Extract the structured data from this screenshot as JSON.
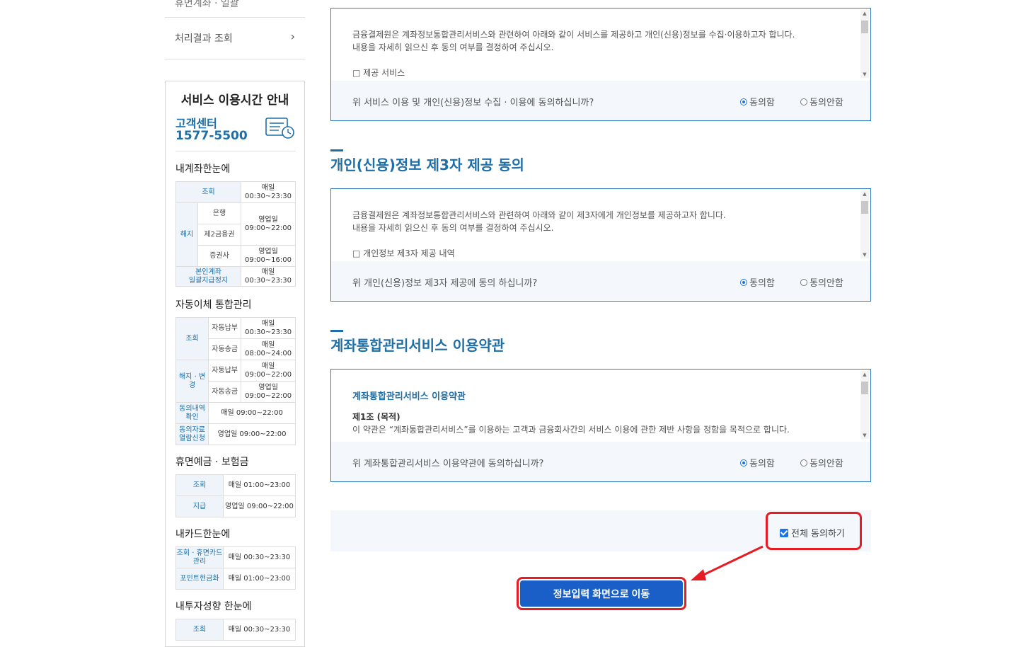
{
  "sidebar": {
    "top_item_partial": "휴면계좌 · 일괄",
    "menu_item": "처리결과 조회",
    "service": {
      "title": "서비스 이용시간 안내",
      "cc_label": "고객센터",
      "cc_number": "1577-5500"
    },
    "sections": {
      "myaccount": "내계좌한눈에",
      "autotransfer": "자동이체 통합관리",
      "dormant": "휴면예금 · 보험금",
      "mycard": "내카드한눈에",
      "invest": "내투자성향 한눈에"
    },
    "t1": {
      "r1": {
        "h": "조회",
        "d": "매일",
        "t": "00:30~23:30"
      },
      "cancel": "해지",
      "r2": {
        "s": "은행",
        "d": "영업일",
        "t": "09:00~22:00"
      },
      "r3": {
        "s": "제2금융권"
      },
      "r4": {
        "s": "증권사",
        "d": "영업일",
        "t": "09:00~16:00"
      },
      "r5": {
        "h1": "본인계좌",
        "h2": "일괄지급정지",
        "d": "매일",
        "t": "00:30~23:30"
      }
    },
    "t2": {
      "view": "조회",
      "change": "해지 · 변경",
      "r1": {
        "s": "자동납부",
        "d": "매일",
        "t": "00:30~23:30"
      },
      "r2": {
        "s": "자동송금",
        "d": "매일",
        "t": "08:00~24:00"
      },
      "r3": {
        "s": "자동납부",
        "d": "매일",
        "t": "09:00~22:00"
      },
      "r4": {
        "s": "자동송금",
        "d": "영업일",
        "t": "09:00~22:00"
      },
      "r5": {
        "h1": "동의내역",
        "h2": "확인",
        "v": "매일 09:00~22:00"
      },
      "r6": {
        "h1": "동의자료",
        "h2": "열람신청",
        "v": "영업일 09:00~22:00"
      }
    },
    "t3": {
      "r1": {
        "h": "조회",
        "v": "매일 01:00~23:00"
      },
      "r2": {
        "h": "지급",
        "v": "영업일 09:00~22:00"
      }
    },
    "t4": {
      "r1": {
        "h1": "조회 · 휴면카드",
        "h2": "관리",
        "v": "매일 00:30~23:30"
      },
      "r2": {
        "h": "포인트현금화",
        "v": "매일 01:00~23:00"
      }
    },
    "t5": {
      "r1": {
        "h": "조회",
        "v": "매일 00:30~23:30"
      }
    }
  },
  "main": {
    "box1": {
      "text1": "금융결제원은 계좌정보통합관리서비스와 관련하여 아래와 같이 서비스를 제공하고 개인(신용)정보를 수집·이용하고자 합니다.",
      "text2": "내용을 자세히 읽으신 후 동의 여부를 결정하여 주십시오.",
      "text3": "□ 제공 서비스",
      "question": "위 서비스 이용 및 개인(신용)정보 수집 · 이용에 동의하십니까?"
    },
    "section2_title": "개인(신용)정보 제3자 제공 동의",
    "box2": {
      "text1": "금융결제원은 계좌정보통합관리서비스와 관련하여 아래와 같이 제3자에게 개인정보를 제공하고자 합니다.",
      "text2": "내용을 자세히 읽으신 후 동의 여부를 결정하여 주십시오.",
      "text3": "□ 개인정보 제3자 제공 내역",
      "question": "위 개인(신용)정보 제3자 제공에 동의 하십니까?"
    },
    "section3_title": "계좌통합관리서비스 이용약관",
    "box3": {
      "terms_title": "계좌통합관리서비스 이용약관",
      "article": "제1조 (목적)",
      "text1": "이 약관은 “계좌통합관리서비스”를 이용하는 고객과 금융회사간의 서비스 이용에 관한 제반 사항을 정함을 목적으로 합니다.",
      "question": "위 계좌통합관리서비스 이용약관에 동의하십니까?"
    },
    "agree_label": "동의함",
    "disagree_label": "동의안함",
    "agree_all": "전체 동의하기",
    "next_button": "정보입력 화면으로 이동",
    "highlight_color": "#e51c23"
  }
}
